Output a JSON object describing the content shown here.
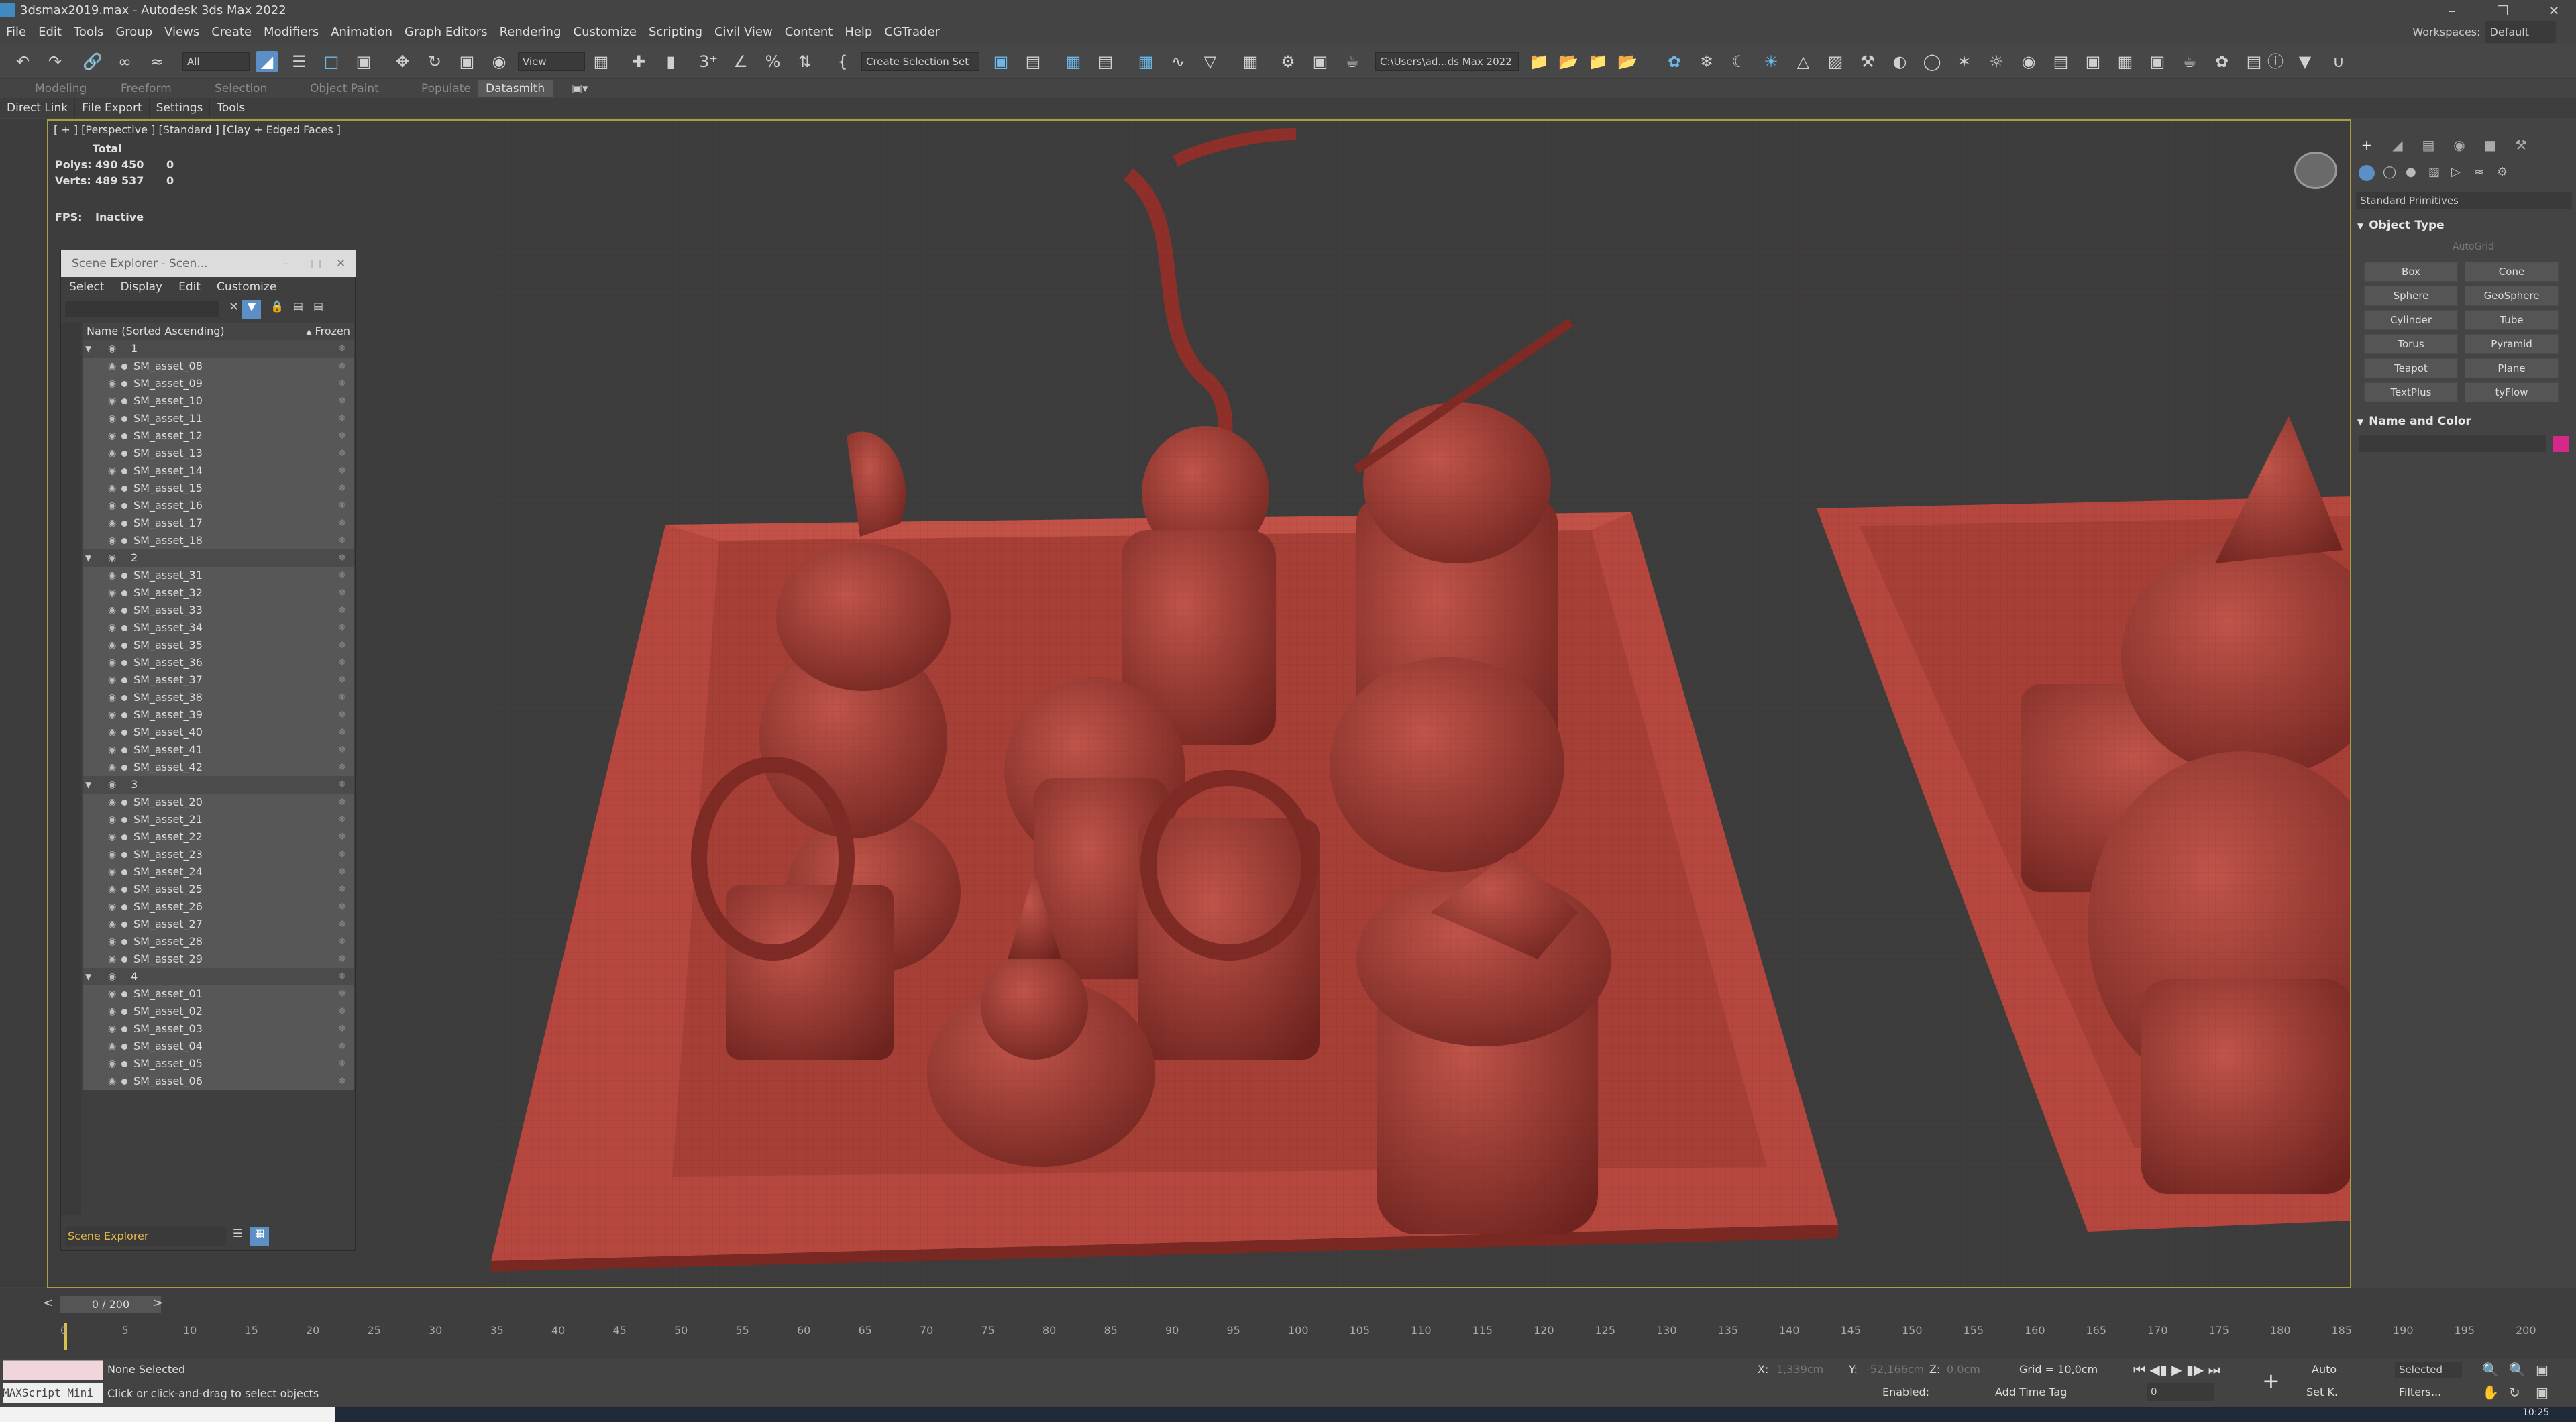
{
  "window": {
    "title": "3dsmax2019.max - Autodesk 3ds Max 2022"
  },
  "menu": [
    "File",
    "Edit",
    "Tools",
    "Group",
    "Views",
    "Create",
    "Modifiers",
    "Animation",
    "Graph Editors",
    "Rendering",
    "Customize",
    "Scripting",
    "Civil View",
    "Content",
    "Help",
    "CGTrader"
  ],
  "workspace": {
    "label": "Workspaces:",
    "value": "Default"
  },
  "toolbar": {
    "filter": "All",
    "view": "View",
    "selection_set": "Create Selection Set",
    "project_path": "C:\\Users\\ad...ds Max 2022"
  },
  "ribbon": {
    "tabs": [
      "Modeling",
      "Freeform",
      "Selection",
      "Object Paint",
      "Populate",
      "Datasmith"
    ],
    "active": "Datasmith"
  },
  "subtabs": [
    "Direct Link",
    "File Export",
    "Settings",
    "Tools"
  ],
  "viewport": {
    "label": "[ + ] [Perspective ] [Standard ] [Clay + Edged Faces ]",
    "stats": {
      "total_label": "Total",
      "polys_label": "Polys:",
      "polys_total": "490 450",
      "polys_sel": "0",
      "verts_label": "Verts:",
      "verts_total": "489 537",
      "verts_sel": "0",
      "fps_label": "FPS:",
      "fps_value": "Inactive"
    }
  },
  "scene_explorer": {
    "title": "Scene Explorer - Scen...",
    "menu": [
      "Select",
      "Display",
      "Edit",
      "Customize"
    ],
    "col_name": "Name (Sorted Ascending)",
    "col_frozen": "▴ Frozen",
    "footer_name": "Scene Explorer",
    "rows": [
      {
        "name": "1",
        "group": true
      },
      {
        "name": "SM_asset_08"
      },
      {
        "name": "SM_asset_09"
      },
      {
        "name": "SM_asset_10"
      },
      {
        "name": "SM_asset_11"
      },
      {
        "name": "SM_asset_12"
      },
      {
        "name": "SM_asset_13"
      },
      {
        "name": "SM_asset_14"
      },
      {
        "name": "SM_asset_15"
      },
      {
        "name": "SM_asset_16"
      },
      {
        "name": "SM_asset_17"
      },
      {
        "name": "SM_asset_18"
      },
      {
        "name": "2",
        "group": true
      },
      {
        "name": "SM_asset_31"
      },
      {
        "name": "SM_asset_32"
      },
      {
        "name": "SM_asset_33"
      },
      {
        "name": "SM_asset_34"
      },
      {
        "name": "SM_asset_35"
      },
      {
        "name": "SM_asset_36"
      },
      {
        "name": "SM_asset_37"
      },
      {
        "name": "SM_asset_38"
      },
      {
        "name": "SM_asset_39"
      },
      {
        "name": "SM_asset_40"
      },
      {
        "name": "SM_asset_41"
      },
      {
        "name": "SM_asset_42"
      },
      {
        "name": "3",
        "group": true
      },
      {
        "name": "SM_asset_20"
      },
      {
        "name": "SM_asset_21"
      },
      {
        "name": "SM_asset_22"
      },
      {
        "name": "SM_asset_23"
      },
      {
        "name": "SM_asset_24"
      },
      {
        "name": "SM_asset_25"
      },
      {
        "name": "SM_asset_26"
      },
      {
        "name": "SM_asset_27"
      },
      {
        "name": "SM_asset_28"
      },
      {
        "name": "SM_asset_29"
      },
      {
        "name": "4",
        "group": true
      },
      {
        "name": "SM_asset_01"
      },
      {
        "name": "SM_asset_02"
      },
      {
        "name": "SM_asset_03"
      },
      {
        "name": "SM_asset_04"
      },
      {
        "name": "SM_asset_05"
      },
      {
        "name": "SM_asset_06"
      }
    ]
  },
  "command_panel": {
    "category": "Standard Primitives",
    "object_type_title": "Object Type",
    "autogrid": "AutoGrid",
    "buttons": [
      "Box",
      "Cone",
      "Sphere",
      "GeoSphere",
      "Cylinder",
      "Tube",
      "Torus",
      "Pyramid",
      "Teapot",
      "Plane",
      "TextPlus",
      "tyFlow"
    ],
    "name_color_title": "Name and Color",
    "object_color": "#d6278a"
  },
  "timeline": {
    "frame": "0 / 200",
    "ticks": [
      "0",
      "5",
      "10",
      "15",
      "20",
      "25",
      "30",
      "35",
      "40",
      "45",
      "50",
      "55",
      "60",
      "65",
      "70",
      "75",
      "80",
      "85",
      "90",
      "95",
      "100",
      "105",
      "110",
      "115",
      "120",
      "125",
      "130",
      "135",
      "140",
      "145",
      "150",
      "155",
      "160",
      "165",
      "170",
      "175",
      "180",
      "185",
      "190",
      "195",
      "200"
    ]
  },
  "status": {
    "maxscript": "MAXScript Mini",
    "selection": "None Selected",
    "hint": "Click or click-and-drag to select objects",
    "x_label": "X:",
    "x_value": "1,339cm",
    "y_label": "Y:",
    "y_value": "-52,166cm",
    "z_label": "Z:",
    "z_value": "0,0cm",
    "grid": "Grid = 10,0cm",
    "enabled": "Enabled:",
    "add_time_tag": "Add Time Tag",
    "auto": "Auto",
    "selected": "Selected",
    "set_key": "Set K.",
    "filters": "Filters...",
    "frame_field": "0",
    "clock": "10:25"
  },
  "colors": {
    "clay": "#b5473e",
    "clay_dark": "#7e2a25",
    "accent": "#5b8fc6",
    "viewport_border": "#a79f3d"
  }
}
